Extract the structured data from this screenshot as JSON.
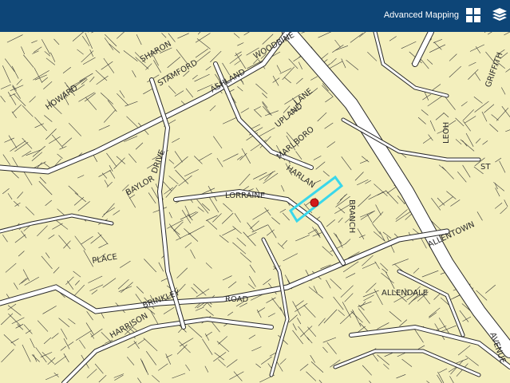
{
  "header": {
    "advanced_mapping_label": "Advanced Mapping",
    "background_color": "#0d4577"
  },
  "icons": {
    "grid": "grid-icon",
    "layers": "layers-icon"
  },
  "map": {
    "land_color": "#f3efbd",
    "road_color": "#ffffff",
    "line_color": "#2a2a2a",
    "highlight_color": "#3ad7ea",
    "marker_color": "#d11a1a",
    "street_labels": [
      "HOWARD",
      "SHARON",
      "STAMFORD",
      "UPLAND",
      "LANE",
      "WOODBINE",
      "ASHLAND",
      "MARLBORO",
      "HARLAN",
      "LORRAINE",
      "BRANCH",
      "BAYLOR",
      "DRIVE",
      "ALLENTOWN",
      "ROAD",
      "BRINKLEY",
      "PLACE",
      "AVENUE",
      "HARRISON",
      "ALLENDALE",
      "GRIFFITH",
      "LEOH",
      "ST"
    ]
  }
}
